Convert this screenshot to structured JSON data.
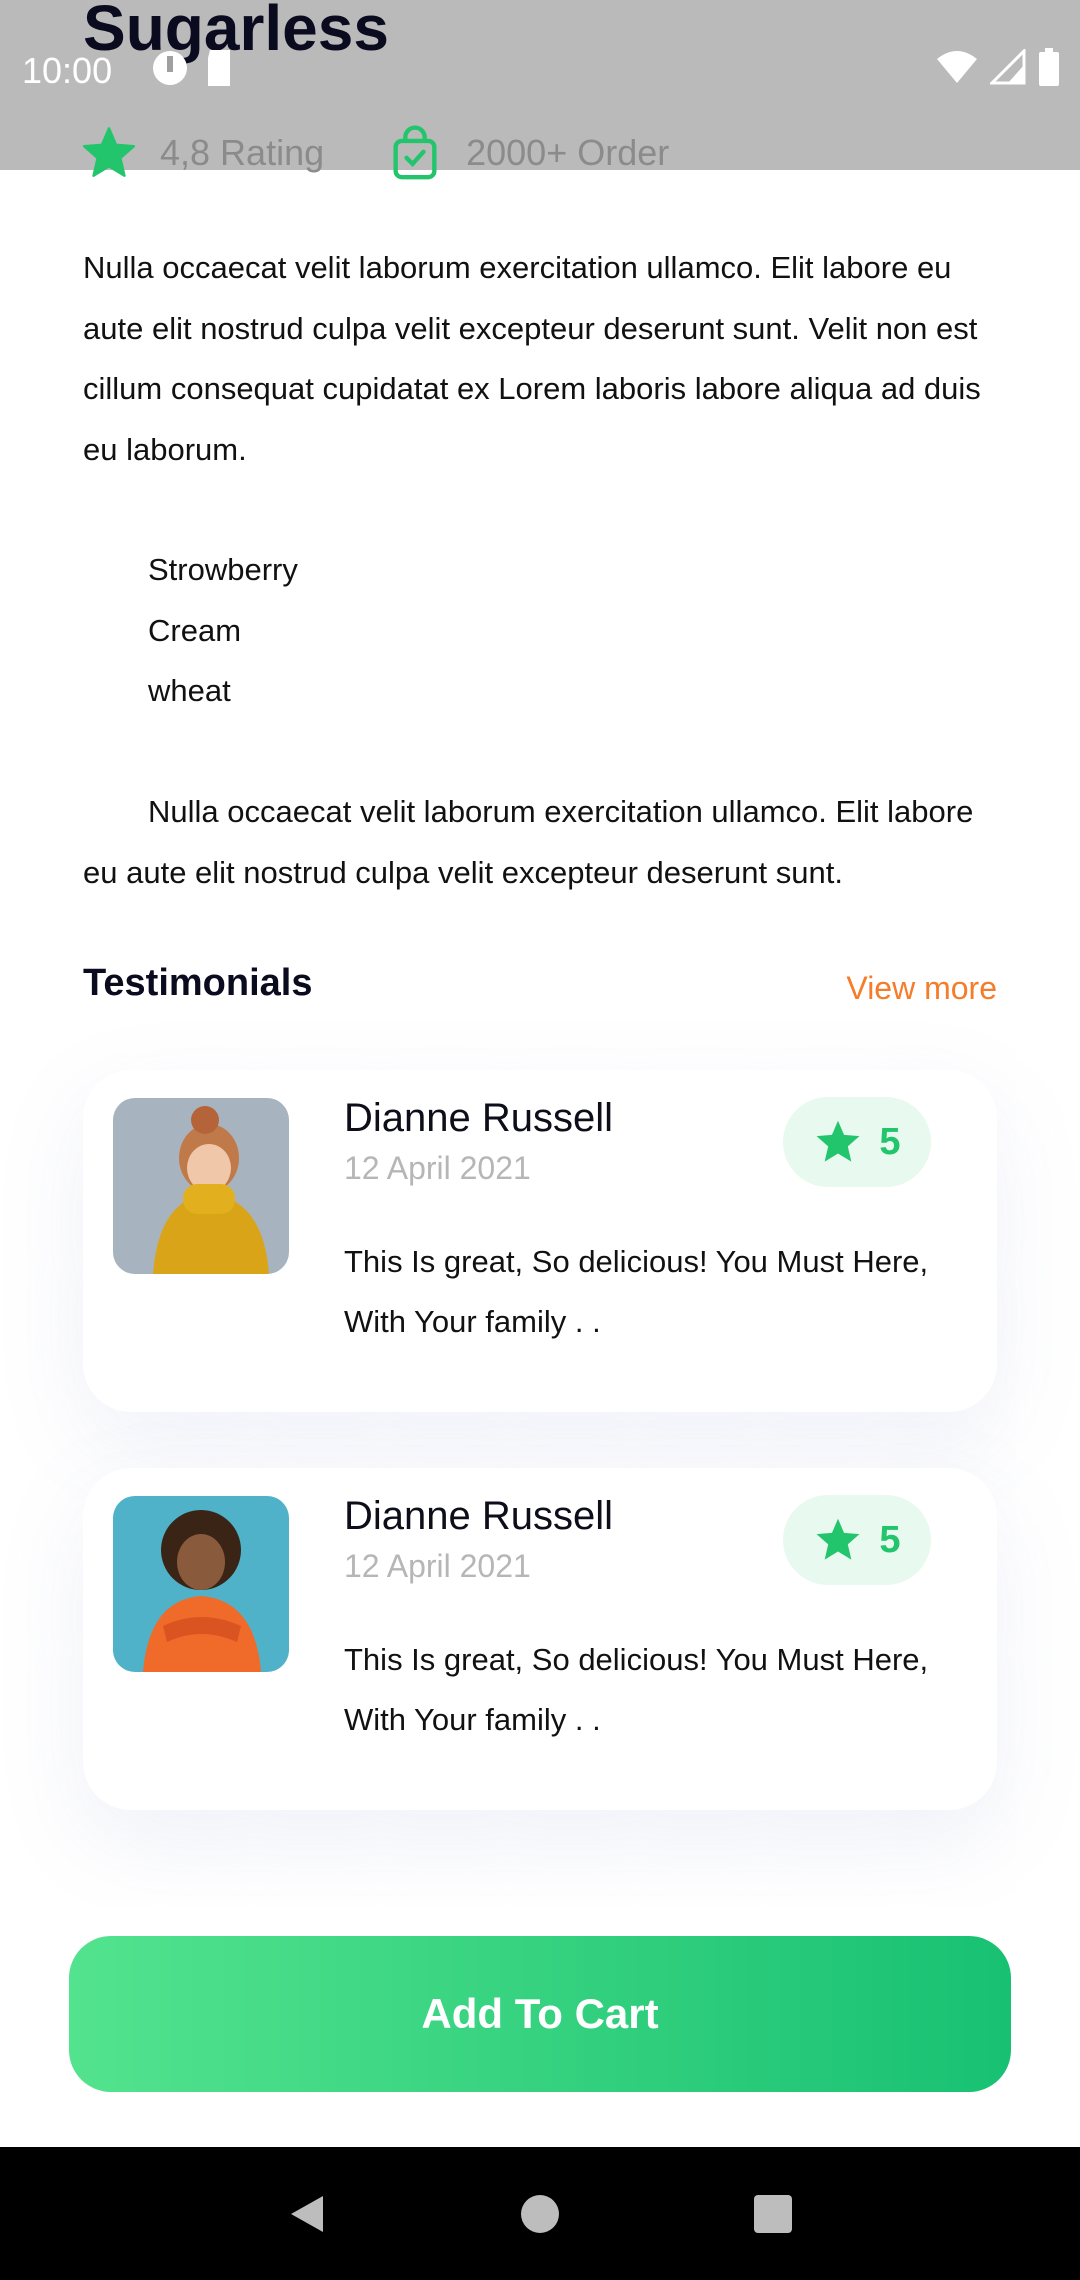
{
  "status_bar": {
    "time": "10:00"
  },
  "product": {
    "title": "Sugarless",
    "rating_text": "4,8 Rating",
    "orders_text": "2000+ Order"
  },
  "description": {
    "paragraph1": "Nulla occaecat velit laborum exercitation ullamco. Elit labore eu aute elit nostrud culpa velit excepteur deserunt sunt. Velit non est cillum consequat cupidatat ex Lorem laboris labore aliqua ad duis eu laborum.",
    "ingredients": [
      "Strowberry",
      "Cream",
      "wheat"
    ],
    "paragraph2": "Nulla occaecat velit laborum exercitation ullamco. Elit labore eu aute elit nostrud culpa velit excepteur deserunt sunt."
  },
  "testimonials": {
    "title": "Testimonials",
    "view_more": "View more",
    "items": [
      {
        "name": "Dianne Russell",
        "date": "12 April 2021",
        "rating": "5",
        "text": "This Is great, So delicious! You Must Here, With Your family . ."
      },
      {
        "name": "Dianne Russell",
        "date": "12 April 2021",
        "rating": "5",
        "text": "This Is great, So delicious! You Must Here, With Your family . ."
      }
    ]
  },
  "cta": {
    "add_to_cart": "Add To Cart"
  },
  "colors": {
    "accent_green": "#22c46c",
    "link_orange": "#f47c2a",
    "rating_pill_bg": "#e8f9ef"
  },
  "icons": [
    "star-icon",
    "shopping-bag-icon",
    "wifi-icon",
    "signal-icon",
    "battery-icon",
    "back-icon",
    "home-icon",
    "recents-icon"
  ]
}
